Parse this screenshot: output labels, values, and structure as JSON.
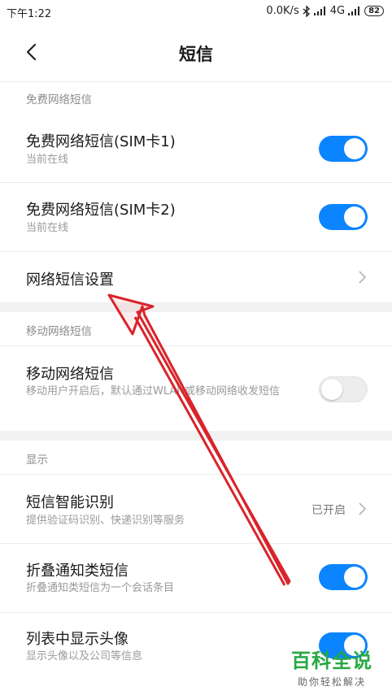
{
  "status_bar": {
    "time": "下午1:22",
    "network_speed": "0.0K/s",
    "network_type": "4G",
    "battery": "82"
  },
  "header": {
    "title": "短信"
  },
  "sections": {
    "free_sms": {
      "header": "免费网络短信",
      "sim1": {
        "title": "免费网络短信(SIM卡1)",
        "subtitle": "当前在线",
        "enabled": true
      },
      "sim2": {
        "title": "免费网络短信(SIM卡2)",
        "subtitle": "当前在线",
        "enabled": true
      },
      "settings": {
        "title": "网络短信设置"
      }
    },
    "mobile_sms": {
      "header": "移动网络短信",
      "toggle": {
        "title": "移动网络短信",
        "subtitle": "移动用户开启后，默认通过WLAN或移动网络收发短信",
        "enabled": false
      }
    },
    "display": {
      "header": "显示",
      "smart_recognition": {
        "title": "短信智能识别",
        "subtitle": "提供验证码识别、快递识别等服务",
        "value": "已开启"
      },
      "fold_notifications": {
        "title": "折叠通知类短信",
        "subtitle": "折叠通知类短信为一个会话条目",
        "enabled": true
      },
      "show_avatar": {
        "title": "列表中显示头像",
        "subtitle": "显示头像以及公司等信息",
        "enabled": true
      }
    }
  },
  "watermark": {
    "main": "百科全说",
    "sub": "助你轻松解决"
  },
  "colors": {
    "toggle_on": "#0b84ff",
    "annotation_arrow": "#d9242b",
    "watermark": "#27a844"
  }
}
